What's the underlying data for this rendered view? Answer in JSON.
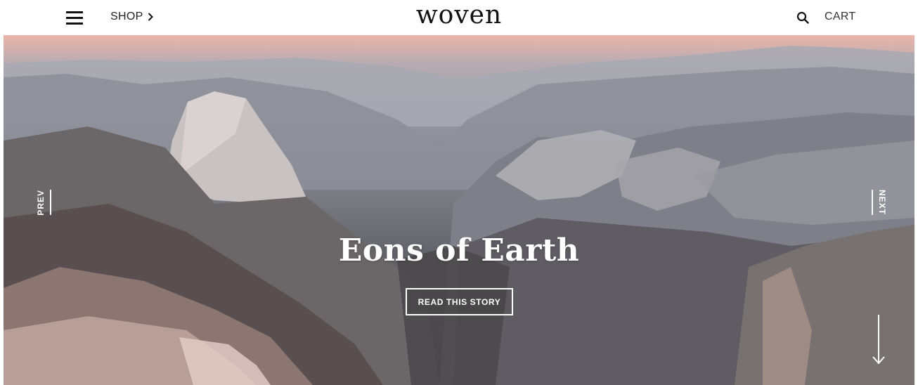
{
  "header": {
    "shop_label": "SHOP",
    "logo": "woven",
    "cart_label": "CART"
  },
  "hero": {
    "title": "Eons of Earth",
    "cta_label": "READ THIS STORY",
    "prev_label": "PREV",
    "next_label": "NEXT"
  },
  "icons": {
    "menu": "hamburger-icon",
    "shop_chevron": "chevron-right-icon",
    "search": "search-icon",
    "scroll": "arrow-down-icon"
  },
  "colors": {
    "header_bg": "#ffffff",
    "text_dark": "#111111",
    "hero_text": "#ffffff",
    "sky_pink": "#f0b4a5"
  }
}
